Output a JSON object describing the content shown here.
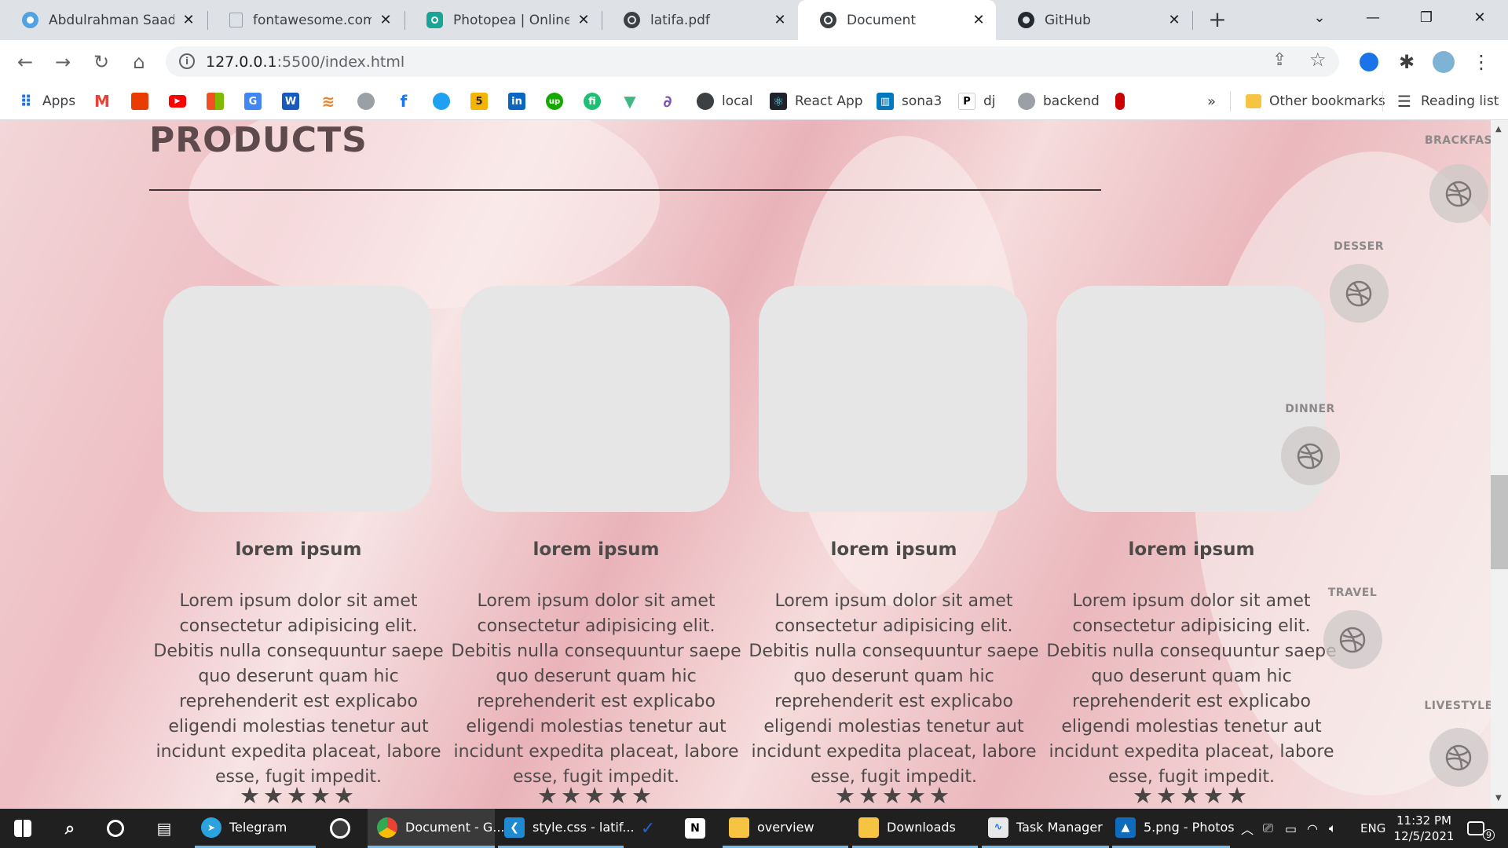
{
  "browser": {
    "tabs": [
      {
        "title": "Abdulrahman Saad |",
        "icon": "circle-avatar-icon"
      },
      {
        "title": "fontawesome.com",
        "icon": "page-icon"
      },
      {
        "title": "Photopea | Online Ph",
        "icon": "photopea-icon"
      },
      {
        "title": "latifa.pdf",
        "icon": "globe-icon"
      },
      {
        "title": "Document",
        "icon": "globe-icon",
        "active": true
      },
      {
        "title": "GitHub",
        "icon": "github-icon"
      }
    ],
    "new_tab": "+",
    "url_host": "127.0.0.1",
    "url_rest": ":5500/index.html",
    "bookmarks": [
      {
        "label": "Apps",
        "icon": "apps-grid-icon"
      },
      {
        "label": "",
        "icon": "gmail-icon"
      },
      {
        "label": "",
        "icon": "office-icon"
      },
      {
        "label": "",
        "icon": "youtube-icon"
      },
      {
        "label": "",
        "icon": "microsoft-icon"
      },
      {
        "label": "",
        "icon": "translate-icon"
      },
      {
        "label": "",
        "icon": "word-icon"
      },
      {
        "label": "",
        "icon": "stackoverflow-icon"
      },
      {
        "label": "",
        "icon": "github-icon"
      },
      {
        "label": "",
        "icon": "facebook-icon"
      },
      {
        "label": "",
        "icon": "circle-icon"
      },
      {
        "label": "",
        "icon": "five-icon"
      },
      {
        "label": "",
        "icon": "linkedin-icon"
      },
      {
        "label": "",
        "icon": "upwork-icon"
      },
      {
        "label": "",
        "icon": "fiverr-icon"
      },
      {
        "label": "",
        "icon": "vue-icon"
      },
      {
        "label": "",
        "icon": "feather-icon"
      },
      {
        "label": "local",
        "icon": "globe-icon"
      },
      {
        "label": "React App",
        "icon": "react-icon"
      },
      {
        "label": "sona3",
        "icon": "trello-icon"
      },
      {
        "label": "dj",
        "icon": "p-icon"
      },
      {
        "label": "backend",
        "icon": "github-icon"
      },
      {
        "label": "",
        "icon": "red-dot-icon"
      }
    ],
    "more_bookmarks": "»",
    "other_bookmarks": "Other bookmarks",
    "reading_list": "Reading list"
  },
  "page": {
    "title": "PRODUCTS",
    "products": [
      {
        "name": "lorem ipsum",
        "description": "Lorem ipsum dolor sit amet consectetur adipisicing elit. Debitis nulla consequuntur saepe quo deserunt quam hic reprehenderit est explicabo eligendi molestias tenetur aut incidunt expedita placeat, labore esse, fugit impedit.",
        "rating": 5,
        "stars": "★★★★★"
      },
      {
        "name": "lorem ipsum",
        "description": "Lorem ipsum dolor sit amet consectetur adipisicing elit. Debitis nulla consequuntur saepe quo deserunt quam hic reprehenderit est explicabo eligendi molestias tenetur aut incidunt expedita placeat, labore esse, fugit impedit.",
        "rating": 5,
        "stars": "★★★★★"
      },
      {
        "name": "lorem ipsum",
        "description": "Lorem ipsum dolor sit amet consectetur adipisicing elit. Debitis nulla consequuntur saepe quo deserunt quam hic reprehenderit est explicabo eligendi molestias tenetur aut incidunt expedita placeat, labore esse, fugit impedit.",
        "rating": 5,
        "stars": "★★★★★"
      },
      {
        "name": "lorem ipsum",
        "description": "Lorem ipsum dolor sit amet consectetur adipisicing elit. Debitis nulla consequuntur saepe quo deserunt quam hic reprehenderit est explicabo eligendi molestias tenetur aut incidunt expedita placeat, labore esse, fugit impedit.",
        "rating": 5,
        "stars": "★★★★★"
      }
    ],
    "side_nav": [
      {
        "label": "BRACKFAS",
        "icon": "dribbble-icon"
      },
      {
        "label": "DESSER",
        "icon": "dribbble-icon"
      },
      {
        "label": "DINNER",
        "icon": "dribbble-icon"
      },
      {
        "label": "TRAVEL",
        "icon": "dribbble-icon"
      },
      {
        "label": "LIVESTYLE",
        "icon": "dribbble-icon"
      }
    ]
  },
  "taskbar": {
    "apps": [
      {
        "label": "",
        "icon": "windows-start-icon"
      },
      {
        "label": "",
        "icon": "search-icon"
      },
      {
        "label": "",
        "icon": "cortana-icon"
      },
      {
        "label": "",
        "icon": "task-view-icon"
      },
      {
        "label": "Telegram",
        "icon": "telegram-icon"
      },
      {
        "label": "",
        "icon": "obs-icon"
      },
      {
        "label": "Document - G...",
        "icon": "chrome-icon"
      },
      {
        "label": "style.css - latif...",
        "icon": "vscode-icon"
      },
      {
        "label": "",
        "icon": "todo-icon"
      },
      {
        "label": "",
        "icon": "notion-icon"
      },
      {
        "label": "overview",
        "icon": "folder-icon"
      },
      {
        "label": "Downloads",
        "icon": "folder-icon"
      },
      {
        "label": "Task Manager",
        "icon": "task-manager-icon"
      },
      {
        "label": "5.png - Photos",
        "icon": "photos-icon"
      }
    ],
    "language": "ENG",
    "time": "11:32 PM",
    "date": "12/5/2021",
    "notifications": "9"
  }
}
